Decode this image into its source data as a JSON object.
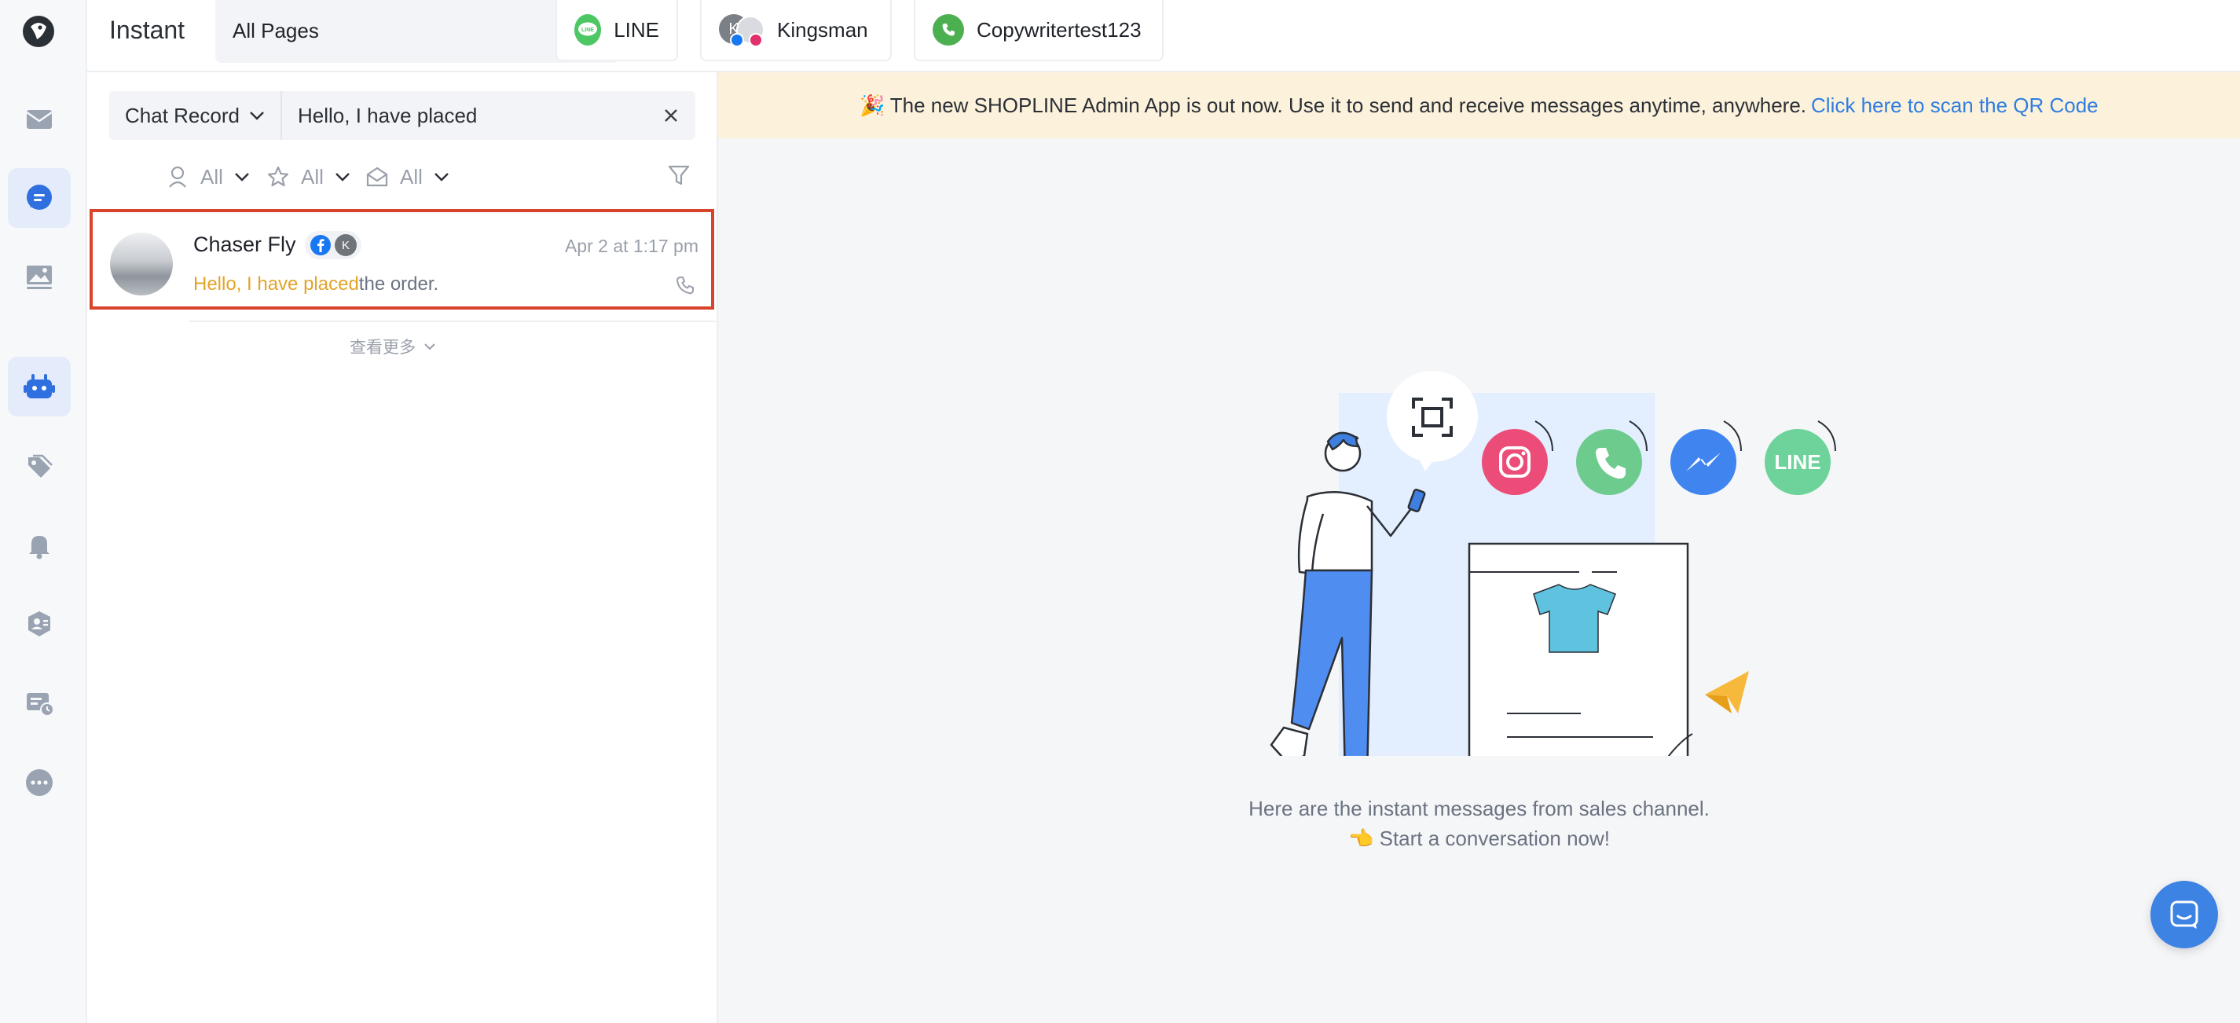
{
  "app": {
    "title": "Instant"
  },
  "rail": {
    "items": [
      {
        "icon": "inbox-icon"
      },
      {
        "icon": "chat-icon",
        "active": true
      },
      {
        "icon": "image-icon"
      },
      {
        "icon": "bot-icon",
        "active": true
      },
      {
        "icon": "tag-icon"
      },
      {
        "icon": "bell-icon"
      },
      {
        "icon": "user-shield-icon"
      },
      {
        "icon": "broadcast-icon"
      },
      {
        "icon": "more-icon"
      }
    ]
  },
  "header": {
    "page_selector": {
      "label": "All Pages"
    },
    "channels": [
      {
        "name": "LINE",
        "icon": "line-icon",
        "color": "#4cc764"
      },
      {
        "name": "Kingsman",
        "icon": "avatar",
        "avatar_initial": "K"
      },
      {
        "name": "Copywritertest123",
        "icon": "whatsapp-icon",
        "color": "#4caf50"
      }
    ]
  },
  "search": {
    "type_label": "Chat Record",
    "value": "Hello, I have placed"
  },
  "filters": {
    "assignee": "All",
    "starred": "All",
    "status": "All"
  },
  "conversations": [
    {
      "name": "Chaser Fly",
      "avatar_initial": "K",
      "time": "Apr 2 at 1:17 pm",
      "preview_highlight": "Hello, I have placed",
      "preview_rest": "the order."
    }
  ],
  "list": {
    "load_more": "查看更多"
  },
  "banner": {
    "emoji": "🎉",
    "text": "The new SHOPLINE Admin App is out now. Use it to send and receive messages anytime, anywhere.",
    "link": "Click here to scan the QR Code"
  },
  "empty_state": {
    "line1": "Here are the instant messages from sales channel.",
    "pointer": "👈",
    "line2": "Start a conversation now!",
    "bubble_label": "LINE"
  },
  "colors": {
    "accent": "#2f7de1",
    "highlight": "#e3a32a",
    "selected_border": "#d9432b",
    "banner_bg": "#fcf2dc"
  }
}
